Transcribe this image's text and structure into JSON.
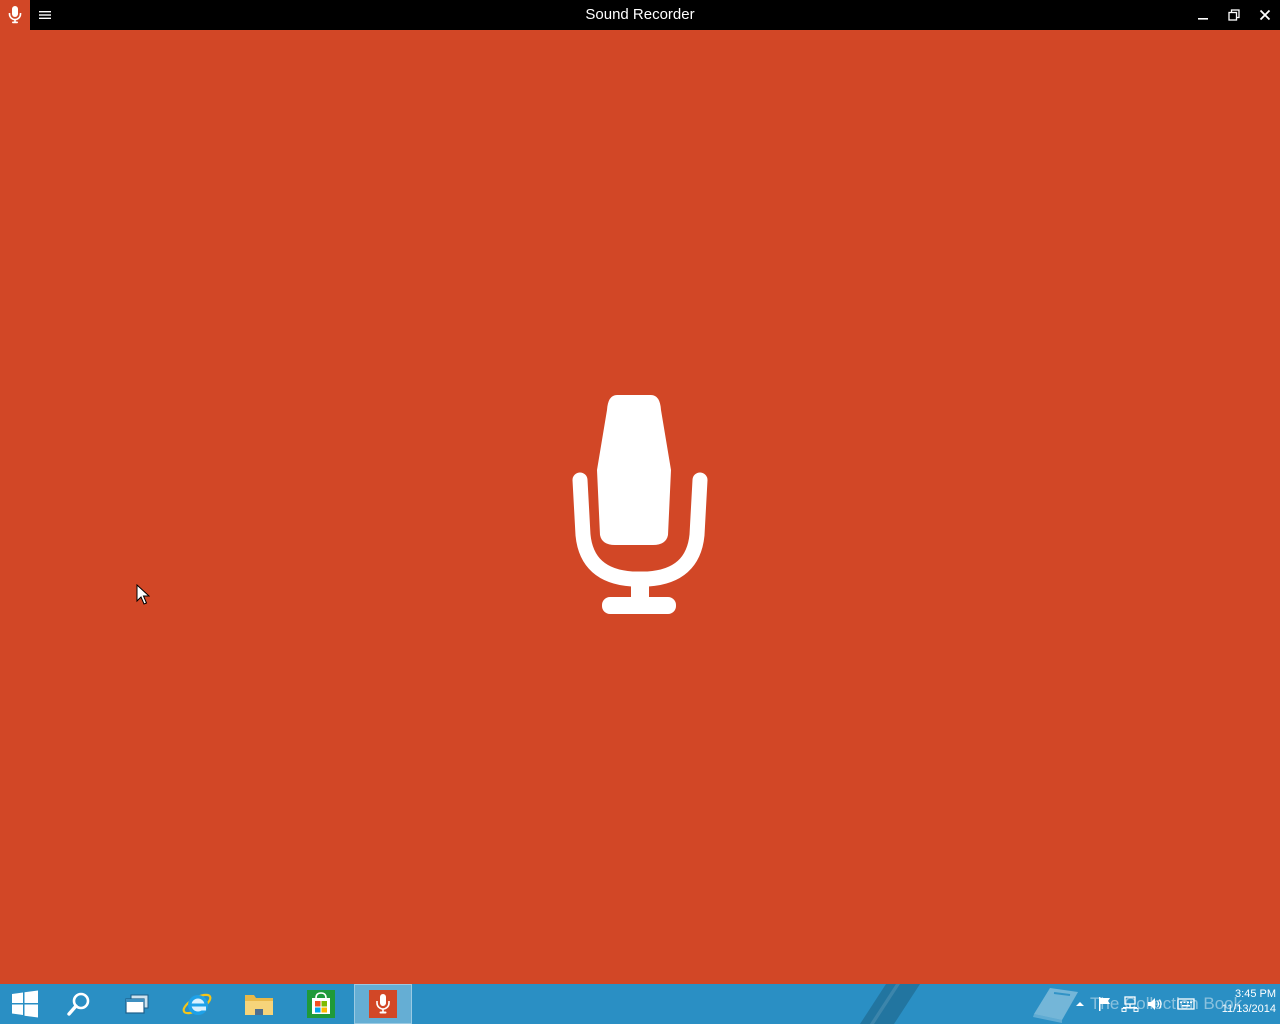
{
  "window": {
    "title": "Sound Recorder",
    "app_icon": "microphone-icon",
    "menu_icon": "hamburger-menu-icon",
    "controls": [
      "minimize-icon",
      "restore-icon",
      "close-icon"
    ]
  },
  "main": {
    "record_icon": "microphone-icon",
    "background_color": "#d24726"
  },
  "taskbar": {
    "items": [
      {
        "name": "start",
        "icon": "windows-logo-icon"
      },
      {
        "name": "search",
        "icon": "search-icon"
      },
      {
        "name": "task-view",
        "icon": "task-view-icon"
      },
      {
        "name": "internet-explorer",
        "icon": "internet-explorer-icon"
      },
      {
        "name": "file-explorer",
        "icon": "folder-icon"
      },
      {
        "name": "store",
        "icon": "store-icon"
      },
      {
        "name": "sound-recorder",
        "icon": "microphone-icon",
        "active": true
      }
    ],
    "watermark": "The Collection Book",
    "tray_icons": [
      "chevron-up-icon",
      "flag-icon",
      "network-icon",
      "volume-icon",
      "keyboard-icon"
    ],
    "clock": {
      "time": "3:45 PM",
      "date": "11/13/2014"
    },
    "color": "#2a8fc4"
  }
}
